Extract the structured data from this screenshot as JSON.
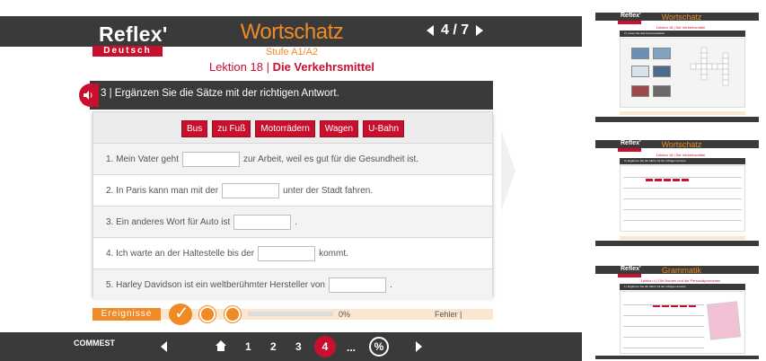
{
  "app": {
    "logo": "Reflex'",
    "logo_sub": "Deutsch",
    "title": "Wortschatz",
    "level": "Stufe A1/A2",
    "page_indicator": "4 / 7"
  },
  "lesson": {
    "prefix": "Lektion 18 | ",
    "name": "Die Verkehrsmittel"
  },
  "task": {
    "instruction": "3 | Ergänzen Sie die Sätze mit der richtigen Antwort."
  },
  "word_bank": [
    "Bus",
    "zu Fuß",
    "Motorrädern",
    "Wagen",
    "U-Bahn"
  ],
  "sentences": [
    {
      "before": "1. Mein Vater geht",
      "after": "zur Arbeit, weil es gut für die Gesundheit ist.",
      "value": ""
    },
    {
      "before": "2. In Paris kann man mit der",
      "after": "unter der Stadt fahren.",
      "value": ""
    },
    {
      "before": "3. Ein anderes Wort für Auto ist",
      "after": ".",
      "value": ""
    },
    {
      "before": "4. Ich warte an der Haltestelle bis der",
      "after": "kommt.",
      "value": ""
    },
    {
      "before": "5. Harley Davidson ist ein weltberühmter Hersteller von",
      "after": ".",
      "value": ""
    }
  ],
  "events": {
    "label": "Ereignisse",
    "progress_text": "0%",
    "progress": 0,
    "errors_label": "Fehler |"
  },
  "footer": {
    "brand": "COMMEST",
    "pages": [
      "1",
      "2",
      "3"
    ],
    "current": "4",
    "ellipsis": "...",
    "score_icon": "%"
  },
  "thumbnails": [
    {
      "logo": "Reflex'",
      "title": "Wortschatz",
      "lesson": "Lektion 18 | Die Verkehrsmittel",
      "task": "2 | Lösen Sie das Kreuzworträtsel."
    },
    {
      "logo": "Reflex'",
      "title": "Wortschatz",
      "lesson": "Lektion 18 | Die Verkehrsmittel",
      "task": "3 | Ergänzen Sie die Sätze mit der richtigen Antwort."
    },
    {
      "logo": "Reflex'",
      "title": "Grammatik",
      "lesson": "Lektion 4 | Die Nomen und die Personalpronomen",
      "task": "1 | Ergänzen Sie die Sätze mit der richtigen Antwort."
    }
  ],
  "colors": {
    "accent_red": "#c8102e",
    "accent_orange": "#f08a24",
    "bar_dark": "#3a3a3a"
  },
  "icons": [
    "speaker-icon",
    "home-icon",
    "checkmark-icon",
    "info-icon",
    "refresh-icon",
    "percent-icon",
    "arrow-left-icon",
    "arrow-right-icon"
  ]
}
